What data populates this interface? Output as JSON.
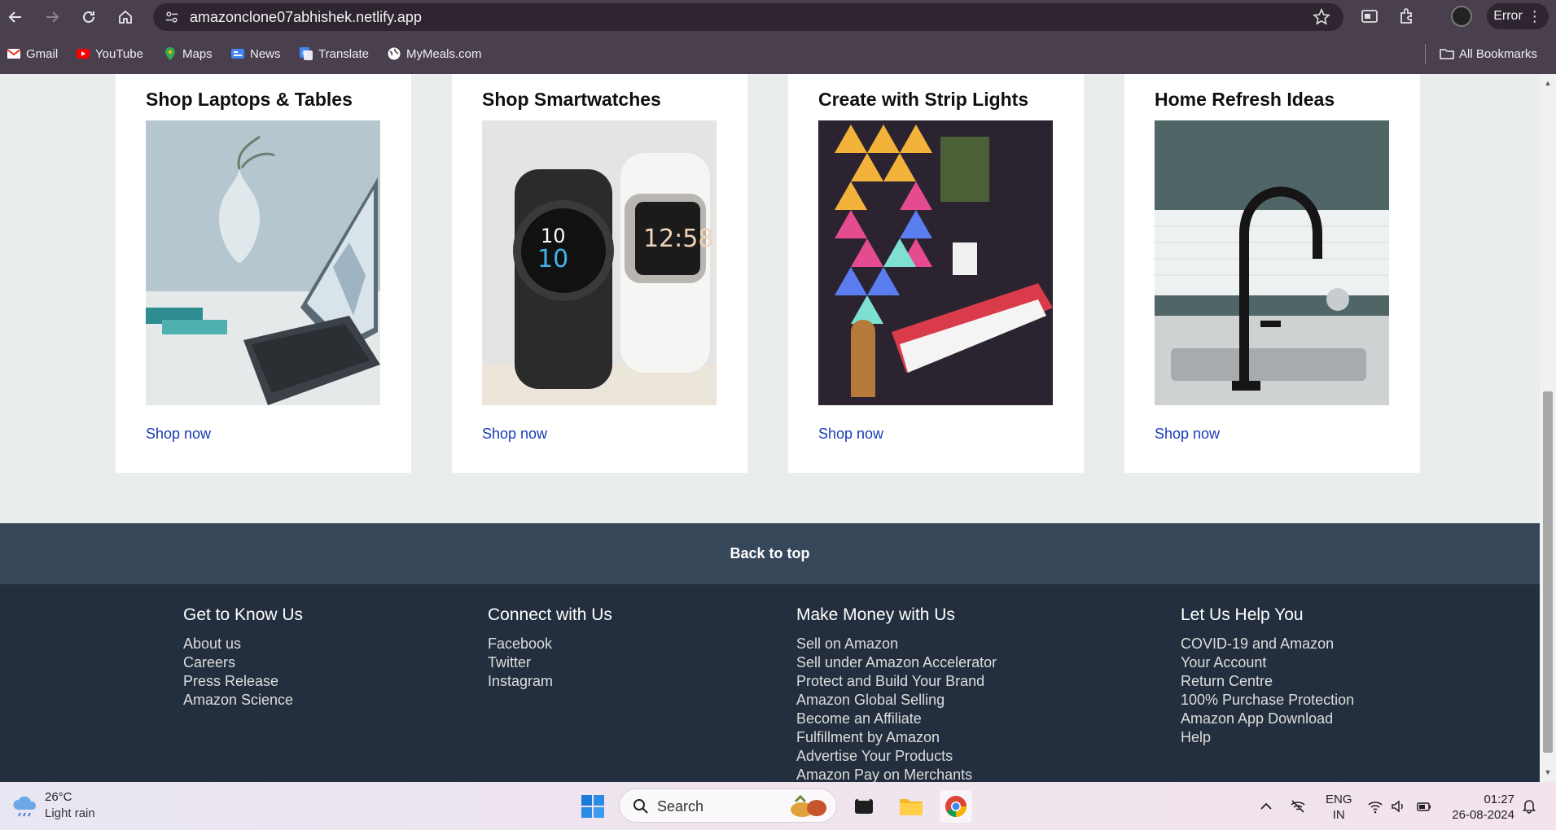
{
  "browser": {
    "url": "amazonclone07abhishek.netlify.app",
    "profile_status": "Error",
    "bookmarks": [
      {
        "label": "Gmail",
        "icon": "gmail-icon",
        "color": "#ea4335"
      },
      {
        "label": "YouTube",
        "icon": "youtube-icon",
        "color": "#ff0000"
      },
      {
        "label": "Maps",
        "icon": "maps-icon",
        "color": "#34a853"
      },
      {
        "label": "News",
        "icon": "news-icon",
        "color": "#4285f4"
      },
      {
        "label": "Translate",
        "icon": "translate-icon",
        "color": "#4285f4"
      },
      {
        "label": "MyMeals.com",
        "icon": "globe-icon",
        "color": "#ffffff"
      }
    ],
    "all_bookmarks": "All Bookmarks"
  },
  "cards": [
    {
      "title": "Shop Laptops & Tables",
      "link": "Shop now",
      "image": "laptop-image"
    },
    {
      "title": "Shop Smartwatches",
      "link": "Shop now",
      "image": "smartwatch-image"
    },
    {
      "title": "Create with Strip Lights",
      "link": "Shop now",
      "image": "strip-lights-image"
    },
    {
      "title": "Home Refresh Ideas",
      "link": "Shop now",
      "image": "faucet-image"
    }
  ],
  "back_to_top": "Back to top",
  "footer": {
    "columns": [
      {
        "title": "Get to Know Us",
        "links": [
          "About us",
          "Careers",
          "Press Release",
          "Amazon Science"
        ]
      },
      {
        "title": "Connect with Us",
        "links": [
          "Facebook",
          "Twitter",
          "Instagram"
        ]
      },
      {
        "title": "Make Money with Us",
        "links": [
          "Sell on Amazon",
          "Sell under Amazon Accelerator",
          "Protect and Build Your Brand",
          "Amazon Global Selling",
          "Become an Affiliate",
          "Fulfillment by Amazon",
          "Advertise Your Products",
          "Amazon Pay on Merchants"
        ]
      },
      {
        "title": "Let Us Help You",
        "links": [
          "COVID-19 and Amazon",
          "Your Account",
          "Return Centre",
          "100% Purchase Protection",
          "Amazon App Download",
          "Help"
        ]
      }
    ]
  },
  "taskbar": {
    "weather_temp": "26°C",
    "weather_desc": "Light rain",
    "search_placeholder": "Search",
    "lang_top": "ENG",
    "lang_bottom": "IN",
    "time": "01:27",
    "date": "26-08-2024"
  },
  "colors": {
    "link": "#1a3bb5",
    "back_to_top_bg": "#37475a",
    "footer_bg": "#232f3e"
  }
}
